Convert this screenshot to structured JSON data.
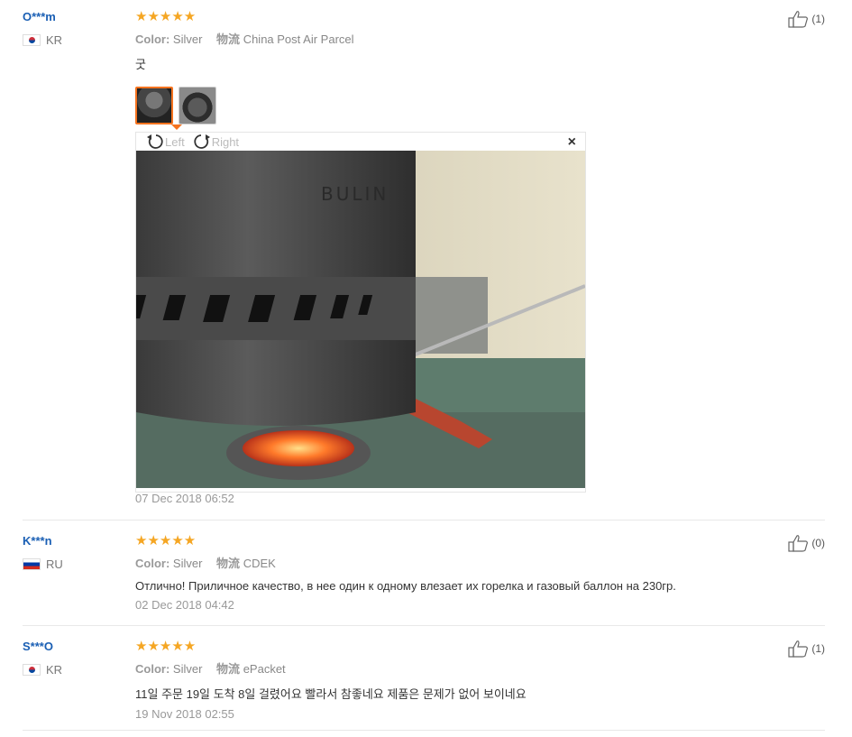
{
  "reviews": [
    {
      "user": "O***m",
      "country": "KR",
      "stars": "★★★★★",
      "color_label": "Color:",
      "color_value": "Silver",
      "ship_label": "物流",
      "ship_value": "China Post Air Parcel",
      "text": "굿",
      "date": "07 Dec 2018 06:52",
      "helpful": "(1)"
    },
    {
      "user": "K***n",
      "country": "RU",
      "stars": "★★★★★",
      "color_label": "Color:",
      "color_value": "Silver",
      "ship_label": "物流",
      "ship_value": "CDEK",
      "text": "Отлично! Приличное качество, в нее один к одному влезает их горелка и газовый баллон на 230гр.",
      "date": "02 Dec 2018 04:42",
      "helpful": "(0)"
    },
    {
      "user": "S***O",
      "country": "KR",
      "stars": "★★★★★",
      "color_label": "Color:",
      "color_value": "Silver",
      "ship_label": "物流",
      "ship_value": "ePacket",
      "text": "11일 주문 19일 도착 8일 걸렸어요 빨라서 참좋네요 제품은 문제가 없어 보이네요",
      "date": "19 Nov 2018 02:55",
      "helpful": "(1)"
    }
  ],
  "viewer": {
    "rotate_left": "Left",
    "rotate_right": "Right",
    "close": "×",
    "photo_brand": "BULIN"
  },
  "colors": {
    "star": "#f5a623",
    "username": "#1a5fb4",
    "active_thumb": "#f5731f"
  }
}
